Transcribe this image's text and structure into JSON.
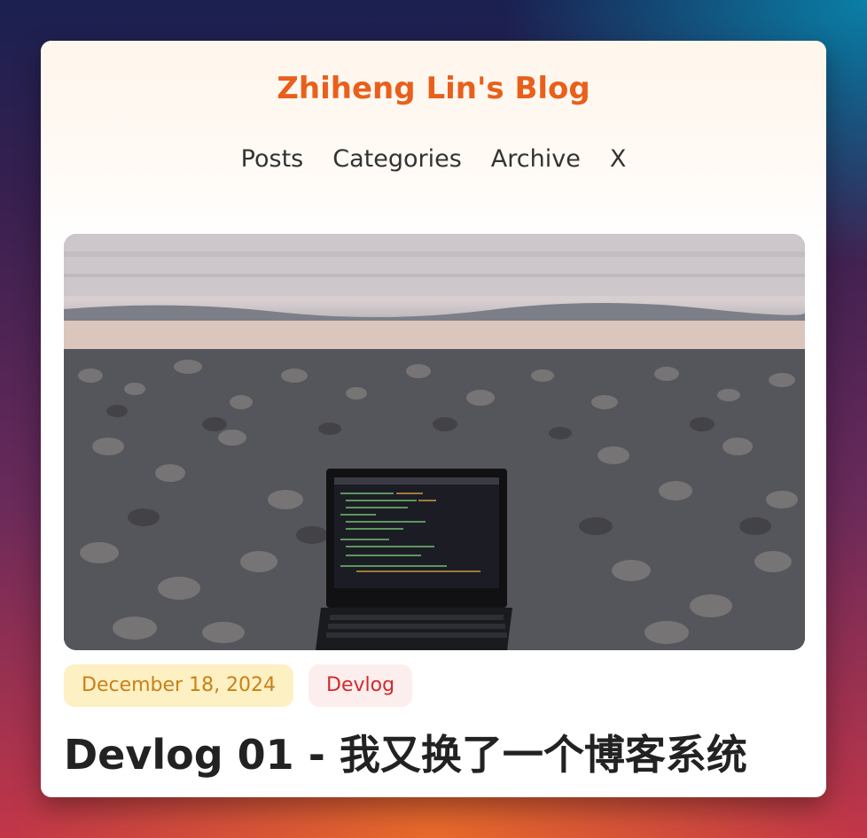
{
  "site": {
    "title": "Zhiheng Lin's Blog"
  },
  "nav": {
    "items": [
      {
        "label": "Posts"
      },
      {
        "label": "Categories"
      },
      {
        "label": "Archive"
      },
      {
        "label": "X"
      }
    ]
  },
  "post": {
    "date": "December 18, 2024",
    "category": "Devlog",
    "title": "Devlog 01 - 我又换了一个博客系统"
  },
  "colors": {
    "accent": "#e8601c",
    "date_badge_bg": "#fdf0c2",
    "date_badge_text": "#c8801a",
    "category_badge_bg": "#fdeeee",
    "category_badge_text": "#d12b2b"
  }
}
